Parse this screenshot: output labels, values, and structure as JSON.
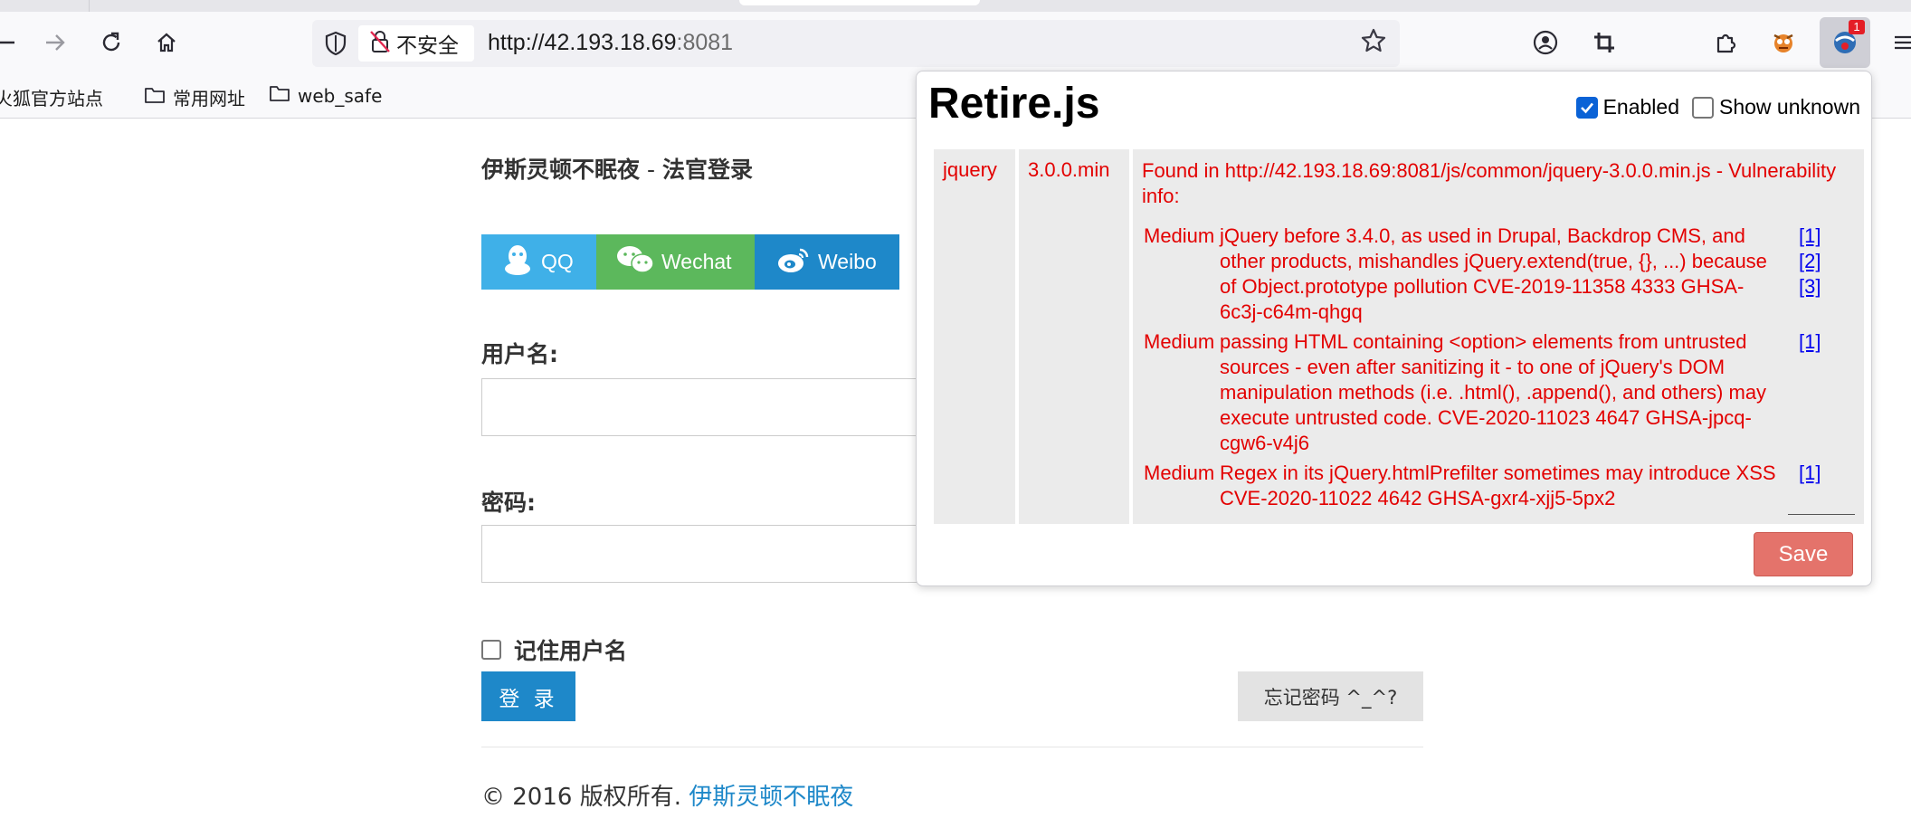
{
  "browser": {
    "security_label": "不安全",
    "url_host": "http://42.193.18.69",
    "url_port": ":8081",
    "extension_badge": "1",
    "bookmarks": [
      {
        "label": "火狐官方站点"
      },
      {
        "label": "常用网址"
      },
      {
        "label": "web_safe"
      }
    ]
  },
  "page": {
    "title_site": "伊斯灵顿不眠夜",
    "title_sep": " - ",
    "title_page": "法官登录",
    "social": [
      {
        "label": "QQ",
        "color": "#3fb0e8"
      },
      {
        "label": "Wechat",
        "color": "#5cb85c"
      },
      {
        "label": "Weibo",
        "color": "#1e88c9"
      }
    ],
    "username_label": "用户名:",
    "password_label": "密码:",
    "remember_label": "记住用户名",
    "login_label": "登 录",
    "forgot_label": "忘记密码 ^_^?",
    "footer_text": "© 2016 版权所有. ",
    "footer_link": "伊斯灵顿不眠夜"
  },
  "retire": {
    "title": "Retire.js",
    "enabled_label": "Enabled",
    "enabled_checked": true,
    "show_unknown_label": "Show unknown",
    "show_unknown_checked": false,
    "component": "jquery",
    "version": "3.0.0.min",
    "found_text": "Found in http://42.193.18.69:8081/js/common/jquery-3.0.0.min.js - Vulnerability info:",
    "vulnerabilities": [
      {
        "severity": "Medium",
        "text": "jQuery before 3.4.0, as used in Drupal, Backdrop CMS, and other products, mishandles jQuery.extend(true, {}, ...) because of Object.prototype pollution CVE-2019-11358 4333 GHSA-6c3j-c64m-qhgq",
        "refs": [
          "[1]",
          "[2]",
          "[3]"
        ]
      },
      {
        "severity": "Medium",
        "text": "passing HTML containing <option> elements from untrusted sources - even after sanitizing it - to one of jQuery's DOM manipulation methods (i.e. .html(), .append(), and others) may execute untrusted code. CVE-2020-11023 4647 GHSA-jpcq-cgw6-v4j6",
        "refs": [
          "[1]"
        ]
      },
      {
        "severity": "Medium",
        "text": "Regex in its jQuery.htmlPrefilter sometimes may introduce XSS CVE-2020-11022 4642 GHSA-gxr4-xjj5-5px2",
        "refs": [
          "[1]"
        ]
      }
    ],
    "save_label": "Save",
    "accent_color": "#e30000"
  }
}
